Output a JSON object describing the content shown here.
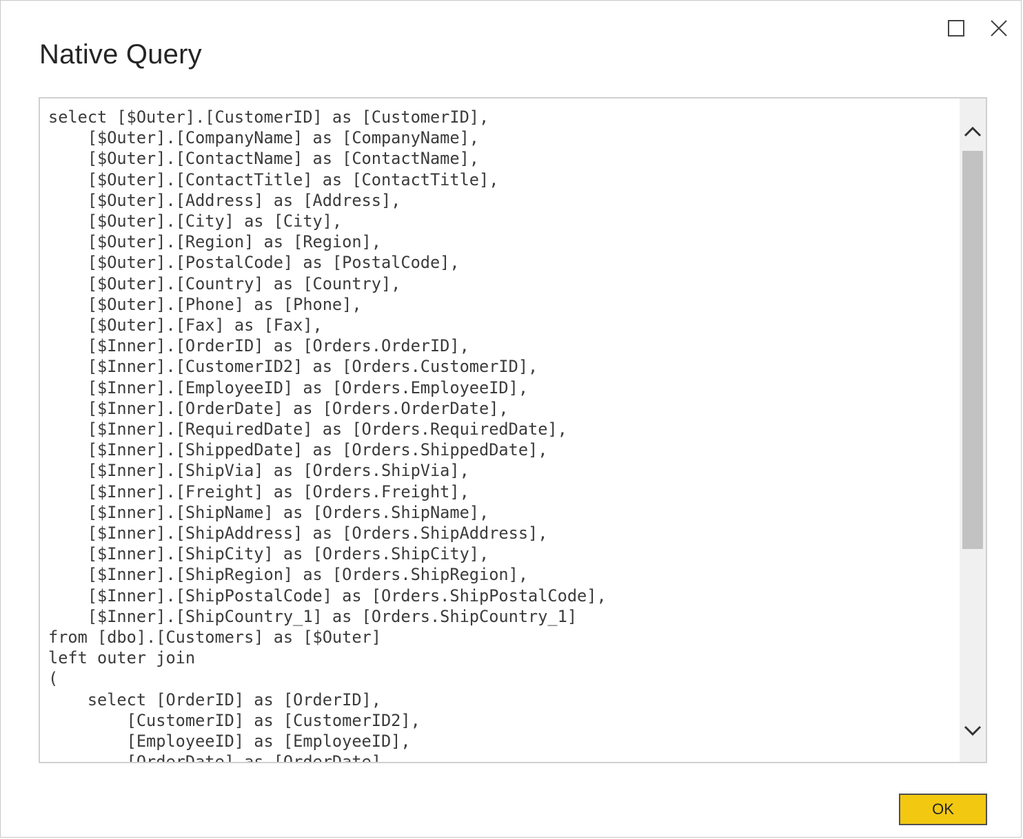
{
  "dialog": {
    "title": "Native Query",
    "controls": {
      "maximize_icon": "maximize-icon",
      "close_icon": "close-icon"
    }
  },
  "query": {
    "lines": [
      "select [$Outer].[CustomerID] as [CustomerID],",
      "    [$Outer].[CompanyName] as [CompanyName],",
      "    [$Outer].[ContactName] as [ContactName],",
      "    [$Outer].[ContactTitle] as [ContactTitle],",
      "    [$Outer].[Address] as [Address],",
      "    [$Outer].[City] as [City],",
      "    [$Outer].[Region] as [Region],",
      "    [$Outer].[PostalCode] as [PostalCode],",
      "    [$Outer].[Country] as [Country],",
      "    [$Outer].[Phone] as [Phone],",
      "    [$Outer].[Fax] as [Fax],",
      "    [$Inner].[OrderID] as [Orders.OrderID],",
      "    [$Inner].[CustomerID2] as [Orders.CustomerID],",
      "    [$Inner].[EmployeeID] as [Orders.EmployeeID],",
      "    [$Inner].[OrderDate] as [Orders.OrderDate],",
      "    [$Inner].[RequiredDate] as [Orders.RequiredDate],",
      "    [$Inner].[ShippedDate] as [Orders.ShippedDate],",
      "    [$Inner].[ShipVia] as [Orders.ShipVia],",
      "    [$Inner].[Freight] as [Orders.Freight],",
      "    [$Inner].[ShipName] as [Orders.ShipName],",
      "    [$Inner].[ShipAddress] as [Orders.ShipAddress],",
      "    [$Inner].[ShipCity] as [Orders.ShipCity],",
      "    [$Inner].[ShipRegion] as [Orders.ShipRegion],",
      "    [$Inner].[ShipPostalCode] as [Orders.ShipPostalCode],",
      "    [$Inner].[ShipCountry_1] as [Orders.ShipCountry_1]",
      "from [dbo].[Customers] as [$Outer]",
      "left outer join",
      "(",
      "    select [OrderID] as [OrderID],",
      "        [CustomerID] as [CustomerID2],",
      "        [EmployeeID] as [EmployeeID],",
      "        [OrderDate] as [OrderDate],"
    ]
  },
  "scrollbar": {
    "up_icon": "chevron-up-icon",
    "down_icon": "chevron-down-icon",
    "colors": {
      "track": "#f0f0f0",
      "thumb": "#c2c2c2"
    }
  },
  "footer": {
    "ok_label": "OK",
    "ok_color": "#f2c811"
  }
}
